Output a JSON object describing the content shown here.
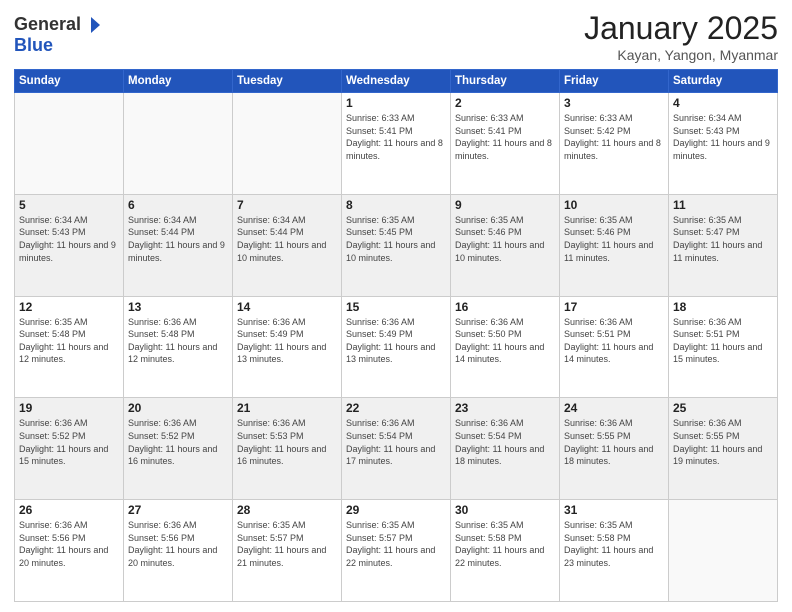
{
  "header": {
    "logo_general": "General",
    "logo_blue": "Blue",
    "month_title": "January 2025",
    "location": "Kayan, Yangon, Myanmar"
  },
  "weekdays": [
    "Sunday",
    "Monday",
    "Tuesday",
    "Wednesday",
    "Thursday",
    "Friday",
    "Saturday"
  ],
  "weeks": [
    [
      {
        "day": "",
        "info": ""
      },
      {
        "day": "",
        "info": ""
      },
      {
        "day": "",
        "info": ""
      },
      {
        "day": "1",
        "info": "Sunrise: 6:33 AM\nSunset: 5:41 PM\nDaylight: 11 hours and 8 minutes."
      },
      {
        "day": "2",
        "info": "Sunrise: 6:33 AM\nSunset: 5:41 PM\nDaylight: 11 hours and 8 minutes."
      },
      {
        "day": "3",
        "info": "Sunrise: 6:33 AM\nSunset: 5:42 PM\nDaylight: 11 hours and 8 minutes."
      },
      {
        "day": "4",
        "info": "Sunrise: 6:34 AM\nSunset: 5:43 PM\nDaylight: 11 hours and 9 minutes."
      }
    ],
    [
      {
        "day": "5",
        "info": "Sunrise: 6:34 AM\nSunset: 5:43 PM\nDaylight: 11 hours and 9 minutes."
      },
      {
        "day": "6",
        "info": "Sunrise: 6:34 AM\nSunset: 5:44 PM\nDaylight: 11 hours and 9 minutes."
      },
      {
        "day": "7",
        "info": "Sunrise: 6:34 AM\nSunset: 5:44 PM\nDaylight: 11 hours and 10 minutes."
      },
      {
        "day": "8",
        "info": "Sunrise: 6:35 AM\nSunset: 5:45 PM\nDaylight: 11 hours and 10 minutes."
      },
      {
        "day": "9",
        "info": "Sunrise: 6:35 AM\nSunset: 5:46 PM\nDaylight: 11 hours and 10 minutes."
      },
      {
        "day": "10",
        "info": "Sunrise: 6:35 AM\nSunset: 5:46 PM\nDaylight: 11 hours and 11 minutes."
      },
      {
        "day": "11",
        "info": "Sunrise: 6:35 AM\nSunset: 5:47 PM\nDaylight: 11 hours and 11 minutes."
      }
    ],
    [
      {
        "day": "12",
        "info": "Sunrise: 6:35 AM\nSunset: 5:48 PM\nDaylight: 11 hours and 12 minutes."
      },
      {
        "day": "13",
        "info": "Sunrise: 6:36 AM\nSunset: 5:48 PM\nDaylight: 11 hours and 12 minutes."
      },
      {
        "day": "14",
        "info": "Sunrise: 6:36 AM\nSunset: 5:49 PM\nDaylight: 11 hours and 13 minutes."
      },
      {
        "day": "15",
        "info": "Sunrise: 6:36 AM\nSunset: 5:49 PM\nDaylight: 11 hours and 13 minutes."
      },
      {
        "day": "16",
        "info": "Sunrise: 6:36 AM\nSunset: 5:50 PM\nDaylight: 11 hours and 14 minutes."
      },
      {
        "day": "17",
        "info": "Sunrise: 6:36 AM\nSunset: 5:51 PM\nDaylight: 11 hours and 14 minutes."
      },
      {
        "day": "18",
        "info": "Sunrise: 6:36 AM\nSunset: 5:51 PM\nDaylight: 11 hours and 15 minutes."
      }
    ],
    [
      {
        "day": "19",
        "info": "Sunrise: 6:36 AM\nSunset: 5:52 PM\nDaylight: 11 hours and 15 minutes."
      },
      {
        "day": "20",
        "info": "Sunrise: 6:36 AM\nSunset: 5:52 PM\nDaylight: 11 hours and 16 minutes."
      },
      {
        "day": "21",
        "info": "Sunrise: 6:36 AM\nSunset: 5:53 PM\nDaylight: 11 hours and 16 minutes."
      },
      {
        "day": "22",
        "info": "Sunrise: 6:36 AM\nSunset: 5:54 PM\nDaylight: 11 hours and 17 minutes."
      },
      {
        "day": "23",
        "info": "Sunrise: 6:36 AM\nSunset: 5:54 PM\nDaylight: 11 hours and 18 minutes."
      },
      {
        "day": "24",
        "info": "Sunrise: 6:36 AM\nSunset: 5:55 PM\nDaylight: 11 hours and 18 minutes."
      },
      {
        "day": "25",
        "info": "Sunrise: 6:36 AM\nSunset: 5:55 PM\nDaylight: 11 hours and 19 minutes."
      }
    ],
    [
      {
        "day": "26",
        "info": "Sunrise: 6:36 AM\nSunset: 5:56 PM\nDaylight: 11 hours and 20 minutes."
      },
      {
        "day": "27",
        "info": "Sunrise: 6:36 AM\nSunset: 5:56 PM\nDaylight: 11 hours and 20 minutes."
      },
      {
        "day": "28",
        "info": "Sunrise: 6:35 AM\nSunset: 5:57 PM\nDaylight: 11 hours and 21 minutes."
      },
      {
        "day": "29",
        "info": "Sunrise: 6:35 AM\nSunset: 5:57 PM\nDaylight: 11 hours and 22 minutes."
      },
      {
        "day": "30",
        "info": "Sunrise: 6:35 AM\nSunset: 5:58 PM\nDaylight: 11 hours and 22 minutes."
      },
      {
        "day": "31",
        "info": "Sunrise: 6:35 AM\nSunset: 5:58 PM\nDaylight: 11 hours and 23 minutes."
      },
      {
        "day": "",
        "info": ""
      }
    ]
  ]
}
